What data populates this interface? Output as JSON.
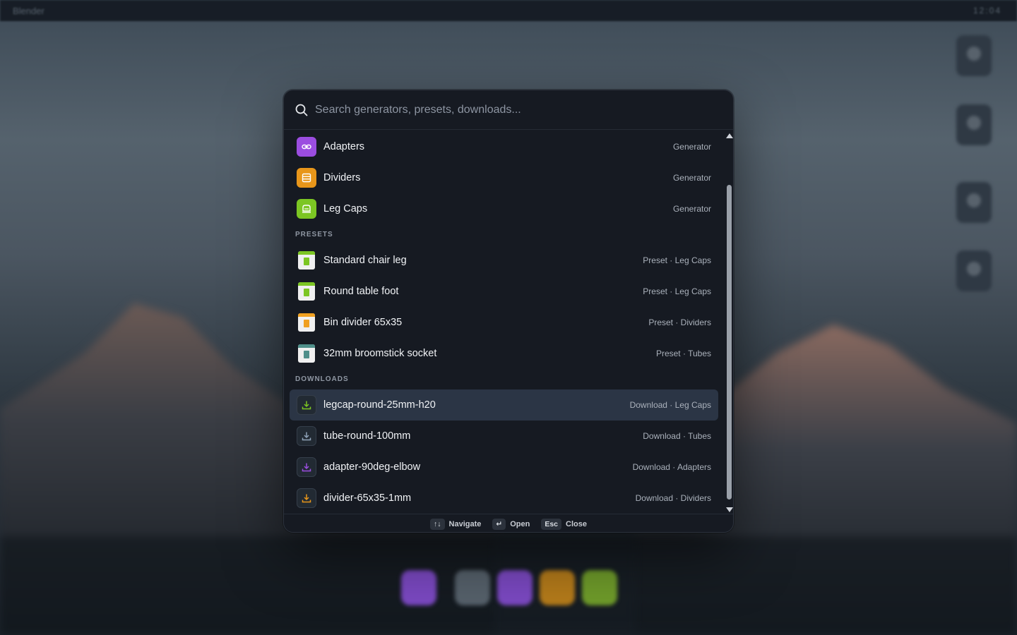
{
  "menubar": {
    "app_name": "Blender",
    "status": "12:04"
  },
  "search": {
    "placeholder": "Search generators, presets, downloads..."
  },
  "generators": [
    {
      "label": "Adapters",
      "meta": "Generator",
      "icon": "link-icon",
      "color": "#9b4de0"
    },
    {
      "label": "Dividers",
      "meta": "Generator",
      "icon": "rows-icon",
      "color": "#e8961a"
    },
    {
      "label": "Leg Caps",
      "meta": "Generator",
      "icon": "cap-icon",
      "color": "#7cc623"
    }
  ],
  "sections": {
    "presets": "PRESETS",
    "downloads": "DOWNLOADS"
  },
  "presets": [
    {
      "label": "Standard chair leg",
      "meta": "Preset · Leg Caps",
      "icon": "bookmark-icon",
      "color": "#7cc623"
    },
    {
      "label": "Round table foot",
      "meta": "Preset · Leg Caps",
      "icon": "bookmark-icon",
      "color": "#7cc623"
    },
    {
      "label": "Bin divider 65x35",
      "meta": "Preset · Dividers",
      "icon": "bookmark-icon",
      "color": "#f0a020"
    },
    {
      "label": "32mm broomstick socket",
      "meta": "Preset · Tubes",
      "icon": "bookmark-icon",
      "color": "#4f8f8a"
    }
  ],
  "downloads": [
    {
      "label": "legcap-round-25mm-h20",
      "meta": "Download · Leg Caps",
      "icon": "download-icon",
      "color": "#7cc623",
      "selected": true
    },
    {
      "label": "tube-round-100mm",
      "meta": "Download · Tubes",
      "icon": "download-icon",
      "color": "#8fa3b8",
      "selected": false
    },
    {
      "label": "adapter-90deg-elbow",
      "meta": "Download · Adapters",
      "icon": "download-icon",
      "color": "#9b4de0",
      "selected": false
    },
    {
      "label": "divider-65x35-1mm",
      "meta": "Download · Dividers",
      "icon": "download-icon",
      "color": "#e8961a",
      "selected": false
    }
  ],
  "footer": {
    "navigate_key": "↑↓",
    "navigate_label": "Navigate",
    "open_key": "↵",
    "open_label": "Open",
    "close_key": "Esc",
    "close_label": "Close"
  },
  "colors": {
    "accent_purple": "#9b4de0",
    "accent_orange": "#e8961a",
    "accent_green": "#7cc623",
    "selected_row": "#2b3545"
  }
}
